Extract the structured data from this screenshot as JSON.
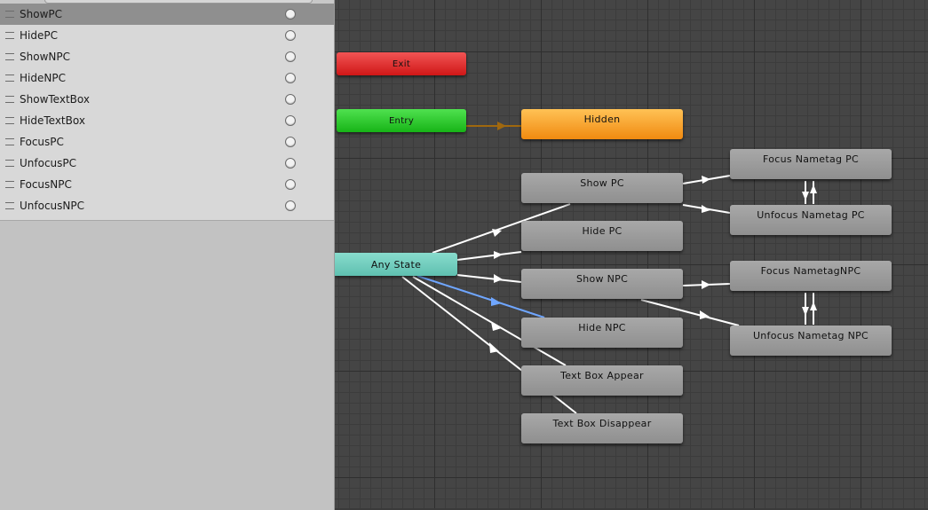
{
  "parameters": [
    {
      "name": "ShowPC",
      "selected": true
    },
    {
      "name": "HidePC",
      "selected": false
    },
    {
      "name": "ShowNPC",
      "selected": false
    },
    {
      "name": "HideNPC",
      "selected": false
    },
    {
      "name": "ShowTextBox",
      "selected": false
    },
    {
      "name": "HideTextBox",
      "selected": false
    },
    {
      "name": "FocusPC",
      "selected": false
    },
    {
      "name": "UnfocusPC",
      "selected": false
    },
    {
      "name": "FocusNPC",
      "selected": false
    },
    {
      "name": "UnfocusNPC",
      "selected": false
    }
  ],
  "states": {
    "exit": "Exit",
    "entry": "Entry",
    "hidden": "Hidden",
    "any_state": "Any State",
    "show_pc": "Show PC",
    "hide_pc": "Hide PC",
    "show_npc": "Show NPC",
    "hide_npc": "Hide NPC",
    "text_box_appear": "Text Box Appear",
    "text_box_disappear": "Text Box Disappear",
    "focus_nametag_pc": "Focus Nametag PC",
    "unfocus_nametag_pc": "Unfocus Nametag PC",
    "focus_nametag_npc": "Focus NametagNPC",
    "unfocus_nametag_npc": "Unfocus Nametag NPC"
  },
  "colors": {
    "exit": "#de2e2e",
    "entry": "#2ccc2c",
    "hidden": "#f8a23a",
    "any_state": "#74cfc0",
    "default_state": "#9c9c9c",
    "transition": "#ffffff",
    "selected_transition": "#6fa6ff",
    "entry_transition": "#a0680e"
  }
}
